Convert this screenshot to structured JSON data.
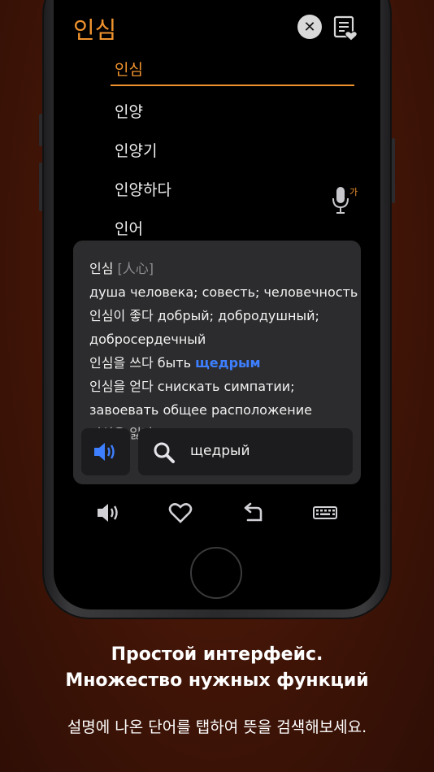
{
  "header": {
    "title": "인심",
    "close_glyph": "✕"
  },
  "word_list": [
    "인심",
    "인양",
    "인양기",
    "인양하다",
    "인어"
  ],
  "mic_badge": "가",
  "definition": {
    "headword": "인심",
    "hanja": "[人心]",
    "lines": [
      "душа человека; совесть; человечность",
      "인심이 좋다 добрый; добродушный;",
      "добросердечный"
    ],
    "line4_prefix": "인심을 쓰다 быть ",
    "line4_link": "щедрым",
    "line5": "인심을 얻다 снискать симпатии;",
    "line6": "завоевать общее расположение",
    "line7_partial": "인심을 잃다"
  },
  "search": {
    "query": "щедрый"
  },
  "caption": {
    "line1": "Простой интерфейс.",
    "line2": "Множество нужных функций",
    "line3": "설명에 나온 단어를 탭하여 뜻을 검색해보세요."
  },
  "colors": {
    "accent": "#f0932e",
    "link": "#3d7fff",
    "background": "#3f1407"
  },
  "icons": [
    "close-icon",
    "favorites-list-icon",
    "microphone-icon",
    "speaker-icon",
    "search-icon",
    "heart-icon",
    "undo-icon",
    "keyboard-icon"
  ]
}
